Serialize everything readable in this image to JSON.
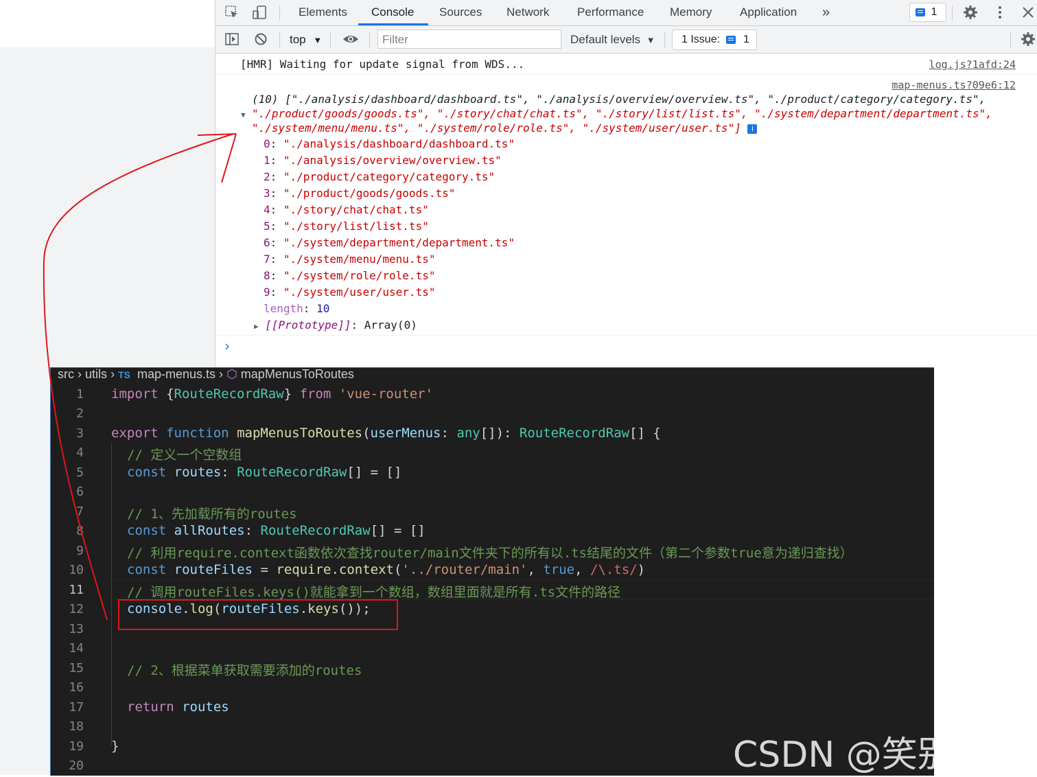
{
  "devtools": {
    "tabs": [
      "Elements",
      "Console",
      "Sources",
      "Network",
      "Performance",
      "Memory",
      "Application"
    ],
    "more_tabs": "»",
    "issues_badge_count": "1",
    "toolbar": {
      "context": "top",
      "filter_placeholder": "Filter",
      "levels": "Default levels",
      "issues_label": "1 Issue:",
      "issues_count": "1"
    }
  },
  "console": {
    "hmr_message": "[HMR] Waiting for update signal from WDS...",
    "hmr_source": "log.js?1afd:24",
    "array_source": "map-menus.ts?09e6:12",
    "array_summary_line1": "(10) [\"./analysis/dashboard/dashboard.ts\", \"./analysis/overview/overview.ts\", \"./product/category/category.ts\",",
    "array_summary_line2": "\"./product/goods/goods.ts\", \"./story/chat/chat.ts\", \"./story/list/list.ts\", \"./system/department/department.ts\",",
    "array_summary_line3": "\"./system/menu/menu.ts\", \"./system/role/role.ts\", \"./system/user/user.ts\"]",
    "entries": [
      {
        "index": "0",
        "value": "\"./analysis/dashboard/dashboard.ts\""
      },
      {
        "index": "1",
        "value": "\"./analysis/overview/overview.ts\""
      },
      {
        "index": "2",
        "value": "\"./product/category/category.ts\""
      },
      {
        "index": "3",
        "value": "\"./product/goods/goods.ts\""
      },
      {
        "index": "4",
        "value": "\"./story/chat/chat.ts\""
      },
      {
        "index": "5",
        "value": "\"./story/list/list.ts\""
      },
      {
        "index": "6",
        "value": "\"./system/department/department.ts\""
      },
      {
        "index": "7",
        "value": "\"./system/menu/menu.ts\""
      },
      {
        "index": "8",
        "value": "\"./system/role/role.ts\""
      },
      {
        "index": "9",
        "value": "\"./system/user/user.ts\""
      }
    ],
    "length_key": "length",
    "length_value": "10",
    "prototype_key": "[[Prototype]]",
    "prototype_value": "Array(0)",
    "prompt": "›"
  },
  "editor": {
    "breadcrumb": {
      "src": "src",
      "utils": "utils",
      "ts_badge": "TS",
      "file": "map-menus.ts",
      "symbol": "mapMenusToRoutes"
    },
    "line_numbers": [
      "1",
      "2",
      "3",
      "4",
      "5",
      "6",
      "7",
      "8",
      "9",
      "10",
      "11",
      "12",
      "13",
      "14",
      "15",
      "16",
      "17",
      "18",
      "19",
      "20"
    ],
    "current_line": "11",
    "code": {
      "l1": [
        "import",
        " {",
        "RouteRecordRaw",
        "} ",
        "from",
        " ",
        "'vue-router'"
      ],
      "l3": [
        "export",
        " ",
        "function",
        " ",
        "mapMenusToRoutes",
        "(",
        "userMenus",
        ": ",
        "any",
        "[]): ",
        "RouteRecordRaw",
        "[] {"
      ],
      "l4": "// 定义一个空数组",
      "l5": [
        "const",
        " ",
        "routes",
        ": ",
        "RouteRecordRaw",
        "[] = []"
      ],
      "l7": "// 1、先加载所有的routes",
      "l8": [
        "const",
        " ",
        "allRoutes",
        ": ",
        "RouteRecordRaw",
        "[] = []"
      ],
      "l9": "// 利用require.context函数依次查找router/main文件夹下的所有以.ts结尾的文件（第二个参数true意为递归查找）",
      "l10": [
        "const",
        " ",
        "routeFiles",
        " = ",
        "require",
        ".",
        "context",
        "(",
        "'../router/main'",
        ", ",
        "true",
        ", ",
        "/\\.ts/",
        ")"
      ],
      "l11": "// 调用routeFiles.keys()就能拿到一个数组，数组里面就是所有.ts文件的路径",
      "l12": [
        "console",
        ".",
        "log",
        "(",
        "routeFiles",
        ".",
        "keys",
        "());"
      ],
      "l15": "// 2、根据菜单获取需要添加的routes",
      "l17": [
        "return",
        " ",
        "routes"
      ],
      "l19": "}"
    }
  },
  "watermark": "CSDN @笑别弯腰",
  "colors": {
    "annotation": "#e0161b",
    "active_tab": "#1a73e8",
    "editor_bg": "#1e1e1e"
  }
}
